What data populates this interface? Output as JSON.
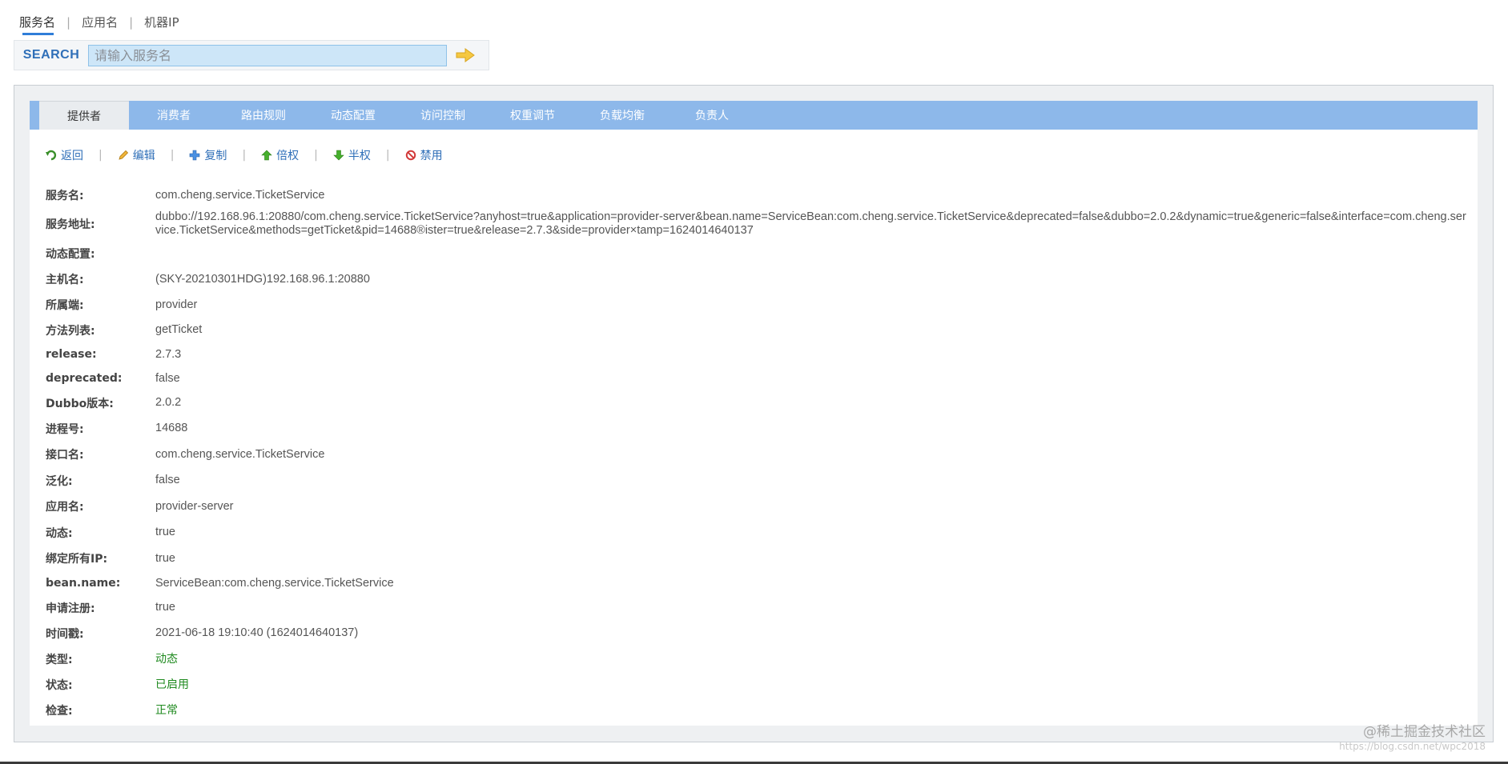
{
  "search_tabs": [
    "服务名",
    "应用名",
    "机器IP"
  ],
  "search": {
    "label": "SEARCH",
    "placeholder": "请输入服务名",
    "go_icon": "arrow-right-icon"
  },
  "tabs": [
    {
      "label": "提供者",
      "active": true
    },
    {
      "label": "消费者",
      "active": false
    },
    {
      "label": "路由规则",
      "active": false
    },
    {
      "label": "动态配置",
      "active": false
    },
    {
      "label": "访问控制",
      "active": false
    },
    {
      "label": "权重调节",
      "active": false
    },
    {
      "label": "负载均衡",
      "active": false
    },
    {
      "label": "负责人",
      "active": false
    }
  ],
  "actions": [
    {
      "label": "返回",
      "icon": "back-arrow-icon",
      "color": "#3a8f2a"
    },
    {
      "label": "编辑",
      "icon": "pencil-icon",
      "color": "#d49a1e"
    },
    {
      "label": "复制",
      "icon": "plus-icon",
      "color": "#2f7ed8"
    },
    {
      "label": "倍权",
      "icon": "arrow-up-icon",
      "color": "#3a9a2a"
    },
    {
      "label": "半权",
      "icon": "arrow-down-icon",
      "color": "#3a9a2a"
    },
    {
      "label": "禁用",
      "icon": "forbidden-icon",
      "color": "#d23a3a"
    }
  ],
  "details": [
    {
      "label": "服务名:",
      "value": "com.cheng.service.TicketService"
    },
    {
      "label": "服务地址:",
      "value": "dubbo://192.168.96.1:20880/com.cheng.service.TicketService?anyhost=true&application=provider-server&bean.name=ServiceBean:com.cheng.service.TicketService&deprecated=false&dubbo=2.0.2&dynamic=true&generic=false&interface=com.cheng.service.TicketService&methods=getTicket&pid=14688®ister=true&release=2.7.3&side=provider×tamp=1624014640137"
    },
    {
      "label": "动态配置:",
      "value": ""
    },
    {
      "label": "主机名:",
      "value": "(SKY-20210301HDG)192.168.96.1:20880"
    },
    {
      "label": "所属端:",
      "value": "provider"
    },
    {
      "label": "方法列表:",
      "value": "getTicket"
    },
    {
      "label": "release:",
      "value": "2.7.3"
    },
    {
      "label": "deprecated:",
      "value": "false"
    },
    {
      "label": "Dubbo版本:",
      "value": "2.0.2"
    },
    {
      "label": "进程号:",
      "value": "14688"
    },
    {
      "label": "接口名:",
      "value": "com.cheng.service.TicketService"
    },
    {
      "label": "泛化:",
      "value": "false"
    },
    {
      "label": "应用名:",
      "value": "provider-server"
    },
    {
      "label": "动态:",
      "value": "true"
    },
    {
      "label": "绑定所有IP:",
      "value": "true"
    },
    {
      "label": "bean.name:",
      "value": "ServiceBean:com.cheng.service.TicketService"
    },
    {
      "label": "申请注册:",
      "value": "true"
    },
    {
      "label": "时间戳:",
      "value": "2021-06-18 19:10:40 (1624014640137)"
    },
    {
      "label": "类型:",
      "value": "动态",
      "status": true
    },
    {
      "label": "状态:",
      "value": "已启用",
      "status": true
    },
    {
      "label": "检查:",
      "value": "正常",
      "status": true
    }
  ],
  "watermark": {
    "main": "@稀土掘金技术社区",
    "url": "https://blog.csdn.net/wpc2018"
  },
  "colors": {
    "tab_bar": "#8db8ea",
    "link": "#2f6fb8",
    "status_green": "#1f8a1f"
  }
}
